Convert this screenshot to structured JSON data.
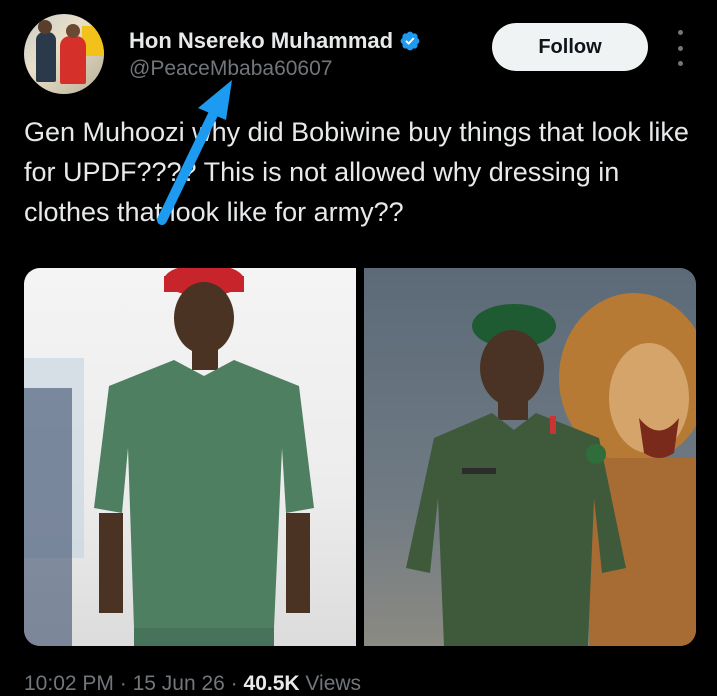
{
  "author": {
    "display_name": "Hon Nsereko Muhammad",
    "handle": "@PeaceMbaba60607",
    "verified": true,
    "verified_color": "#1d9bf0"
  },
  "actions": {
    "follow_label": "Follow"
  },
  "tweet": {
    "text": "Gen Muhoozi why did Bobiwine buy things that look like for UPDF???? This is not allowed why dressing in clothes that look like for army??"
  },
  "media": {
    "image_count": 2
  },
  "meta": {
    "time": "10:02 PM",
    "separator": "·",
    "date": "15 Jun 26",
    "views_count": "40.5K",
    "views_label": "Views"
  },
  "colors": {
    "background": "#000000",
    "text": "#e7e9ea",
    "secondary": "#71767b",
    "annotation_arrow": "#1d9bf0"
  }
}
